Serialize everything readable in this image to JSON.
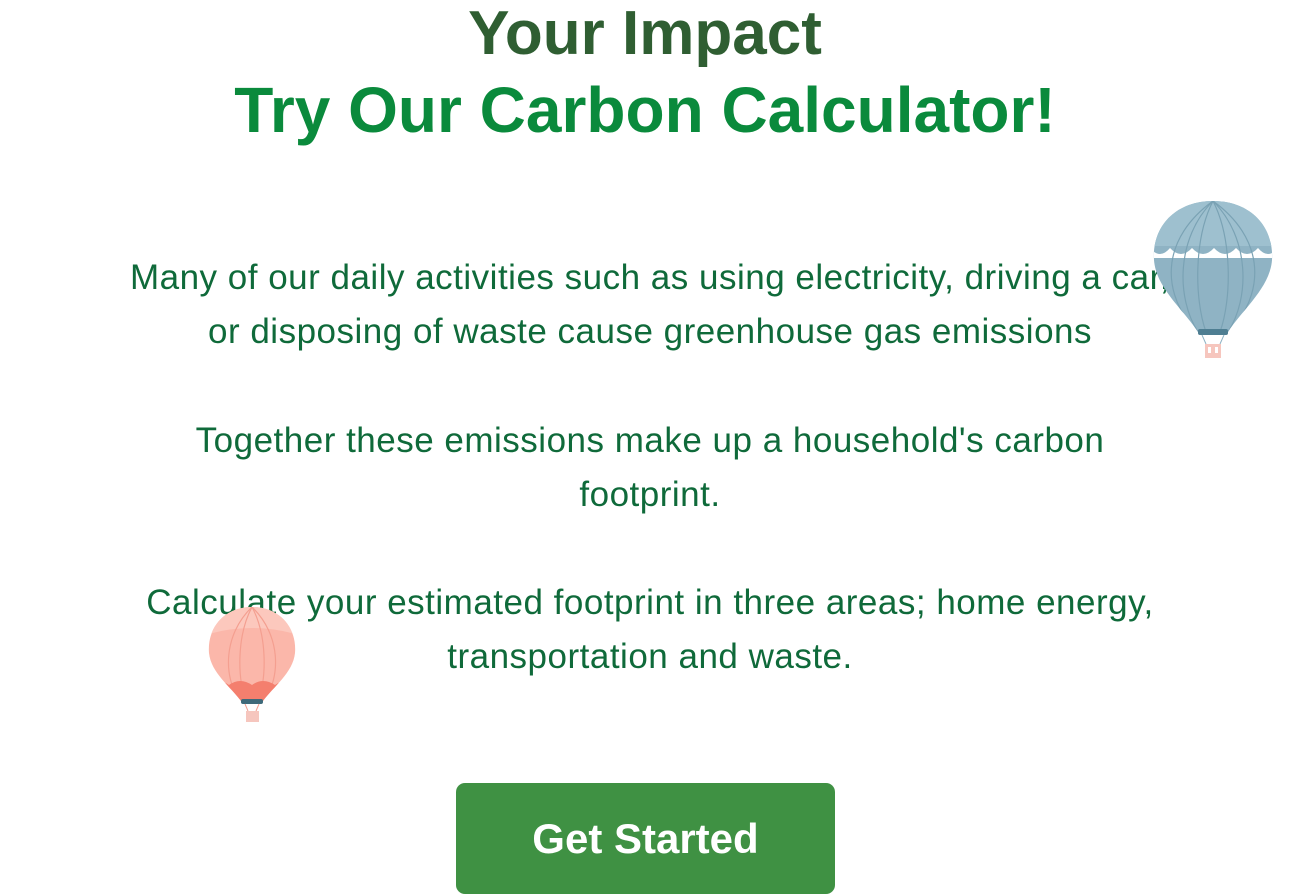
{
  "header": {
    "title_line1": "Your Impact",
    "title_line2": "Try Our Carbon Calculator!"
  },
  "intro": {
    "paragraph1": [
      "Many of our daily activities such as using electricity, driving a car,",
      "or disposing of waste cause greenhouse gas emissions"
    ],
    "paragraph2": [
      "Together these emissions make up a household's carbon",
      "footprint."
    ],
    "paragraph3": [
      "Calculate your estimated footprint in three areas; home energy,",
      "transportation and waste."
    ]
  },
  "cta": {
    "label": "Get Started"
  },
  "decor": {
    "balloon_blue_icon": "hot-air-balloon-icon",
    "balloon_pink_icon": "hot-air-balloon-icon"
  },
  "colors": {
    "title_dark_green": "#2f5e32",
    "title_bright_green": "#0a8a3c",
    "body_text_green": "#0f6a3a",
    "button_green": "#3f9143"
  }
}
